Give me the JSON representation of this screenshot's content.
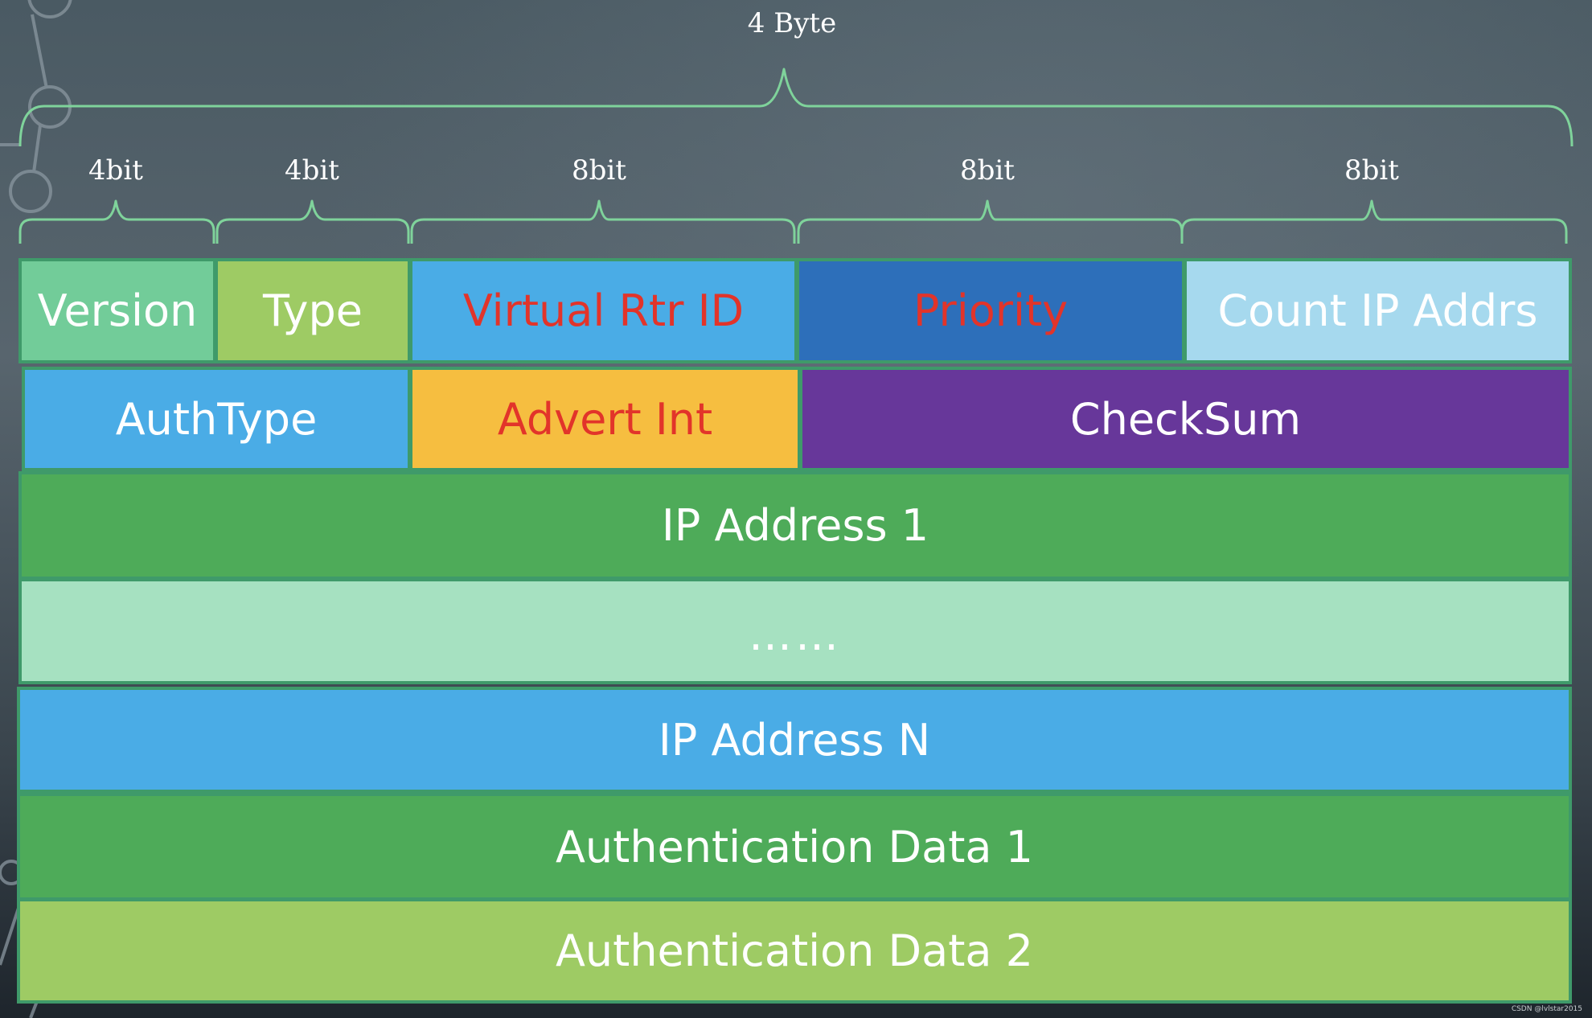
{
  "colors": {
    "brace": "#7fd39b",
    "cell_border": "#3f9a6a",
    "text_white": "#ffffff",
    "text_red": "#e2342a"
  },
  "header": {
    "total_label": "4 Byte",
    "field_widths": [
      "4bit",
      "4bit",
      "8bit",
      "8bit",
      "8bit"
    ]
  },
  "rows": {
    "row1": {
      "version": "Version",
      "type": "Type",
      "virtual_rtr_id": "Virtual Rtr ID",
      "priority": "Priority",
      "count_ip_addrs": "Count IP Addrs"
    },
    "row2": {
      "auth_type": "AuthType",
      "advert_int": "Advert Int",
      "checksum": "CheckSum"
    },
    "ip_address_1": "IP Address 1",
    "ellipsis": "……",
    "ip_address_n": "IP Address N",
    "auth_data_1": "Authentication Data 1",
    "auth_data_2": "Authentication Data 2"
  },
  "watermark": "CSDN @lvlstar2015"
}
